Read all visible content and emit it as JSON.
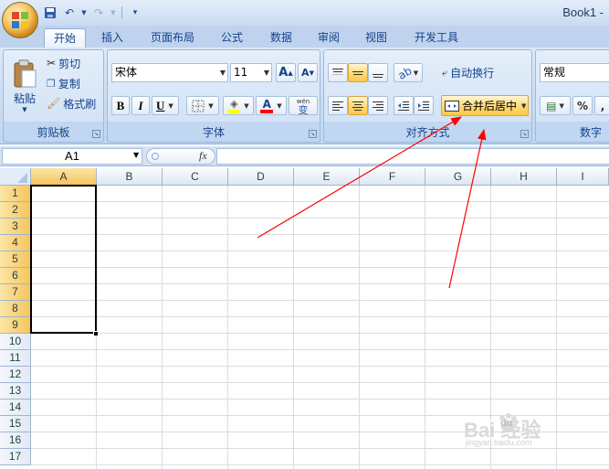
{
  "window": {
    "title": "Book1 -"
  },
  "tabs": [
    {
      "label": "开始",
      "active": true
    },
    {
      "label": "插入",
      "active": false
    },
    {
      "label": "页面布局",
      "active": false
    },
    {
      "label": "公式",
      "active": false
    },
    {
      "label": "数据",
      "active": false
    },
    {
      "label": "审阅",
      "active": false
    },
    {
      "label": "视图",
      "active": false
    },
    {
      "label": "开发工具",
      "active": false
    }
  ],
  "clipboard": {
    "label": "剪贴板",
    "paste": "粘贴",
    "cut": "剪切",
    "copy": "复制",
    "format_painter": "格式刷"
  },
  "font": {
    "label": "字体",
    "name": "宋体",
    "size": "11",
    "bold": "B",
    "italic": "I",
    "underline": "U",
    "font_color": "A",
    "phonetic": "wén",
    "phonetic_char": "变",
    "grow": "A",
    "shrink": "A",
    "font_color_hex": "#ff0000",
    "fill_color_hex": "#ffff00"
  },
  "alignment": {
    "label": "对齐方式",
    "wrap_text": "自动换行",
    "merge_center": "合并后居中"
  },
  "number": {
    "label": "数字",
    "format": "常规",
    "percent": "%"
  },
  "formula_bar": {
    "name_box": "A1",
    "fx": "fx",
    "value": ""
  },
  "columns": [
    "A",
    "B",
    "C",
    "D",
    "E",
    "F",
    "G",
    "H",
    "I"
  ],
  "rows": [
    "1",
    "2",
    "3",
    "4",
    "5",
    "6",
    "7",
    "8",
    "9",
    "10",
    "11",
    "12",
    "13",
    "14",
    "15",
    "16",
    "17"
  ],
  "selection": {
    "range": "A1:A9"
  },
  "watermark": {
    "text": "Bai 经验",
    "du": "du",
    "url": "jingyan.baidu.com"
  },
  "colors": {
    "accent": "#15428b",
    "highlight": "#ffc84a",
    "annotation_arrow": "#ff0000"
  }
}
